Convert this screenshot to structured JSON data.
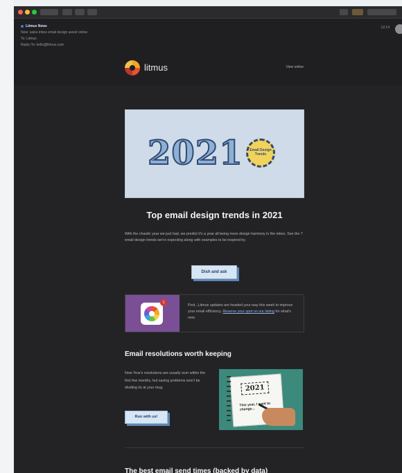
{
  "toolbar": {
    "buttons": [
      "",
      "",
      "",
      ""
    ],
    "right_buttons": [
      "",
      "",
      ""
    ]
  },
  "mail_header": {
    "from": "Litmus News",
    "subject": "New: sales inbox email design assist online",
    "to": "Litmus",
    "reply_to": "hello@litmus.com",
    "date": "12:14"
  },
  "email": {
    "brand": "litmus",
    "view_online": "View online",
    "hero": {
      "year": "2021",
      "badge": "Email Design Trends"
    },
    "trends": {
      "title": "Top email design trends in 2021",
      "body": "With the chaotic year we just had, we predict it's a year all being more design harmony in the inbox. See the 7 email design trends we're expecting along with examples to be inspired by.",
      "button": "Dish and ask"
    },
    "promo": {
      "badge": "1",
      "text": "Psst...Litmus updates are headed your way this week to improve your email efficiency.",
      "link": "Reserve your spot on our listing",
      "text_after": " for what's new."
    },
    "resolutions": {
      "title": "Email resolutions worth keeping",
      "body": "New Year's resolutions are usually over within the first few months, but saving problems won't be dividing its at your mug.",
      "button": "Run with us!",
      "art_year": "2021",
      "art_note": "This year, I want to change..."
    },
    "send_times": {
      "title": "The best email send times (backed by data)"
    }
  }
}
